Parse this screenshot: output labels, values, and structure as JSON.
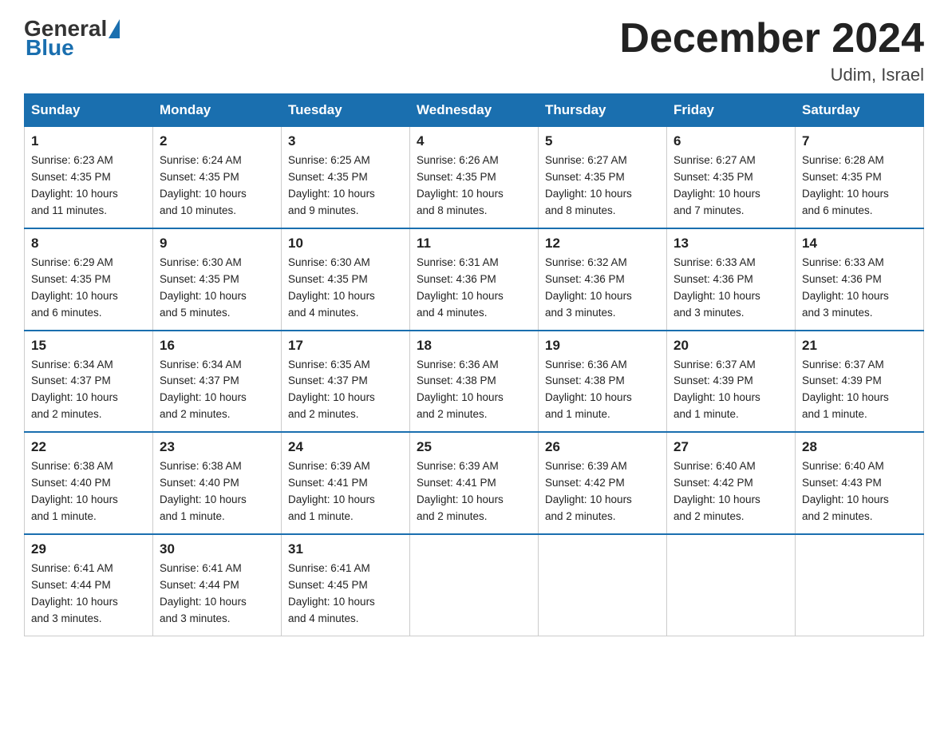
{
  "header": {
    "title": "December 2024",
    "location": "Udim, Israel",
    "logo_general": "General",
    "logo_blue": "Blue"
  },
  "weekdays": [
    "Sunday",
    "Monday",
    "Tuesday",
    "Wednesday",
    "Thursday",
    "Friday",
    "Saturday"
  ],
  "weeks": [
    [
      {
        "day": "1",
        "sunrise": "6:23 AM",
        "sunset": "4:35 PM",
        "daylight": "10 hours and 11 minutes."
      },
      {
        "day": "2",
        "sunrise": "6:24 AM",
        "sunset": "4:35 PM",
        "daylight": "10 hours and 10 minutes."
      },
      {
        "day": "3",
        "sunrise": "6:25 AM",
        "sunset": "4:35 PM",
        "daylight": "10 hours and 9 minutes."
      },
      {
        "day": "4",
        "sunrise": "6:26 AM",
        "sunset": "4:35 PM",
        "daylight": "10 hours and 8 minutes."
      },
      {
        "day": "5",
        "sunrise": "6:27 AM",
        "sunset": "4:35 PM",
        "daylight": "10 hours and 8 minutes."
      },
      {
        "day": "6",
        "sunrise": "6:27 AM",
        "sunset": "4:35 PM",
        "daylight": "10 hours and 7 minutes."
      },
      {
        "day": "7",
        "sunrise": "6:28 AM",
        "sunset": "4:35 PM",
        "daylight": "10 hours and 6 minutes."
      }
    ],
    [
      {
        "day": "8",
        "sunrise": "6:29 AM",
        "sunset": "4:35 PM",
        "daylight": "10 hours and 6 minutes."
      },
      {
        "day": "9",
        "sunrise": "6:30 AM",
        "sunset": "4:35 PM",
        "daylight": "10 hours and 5 minutes."
      },
      {
        "day": "10",
        "sunrise": "6:30 AM",
        "sunset": "4:35 PM",
        "daylight": "10 hours and 4 minutes."
      },
      {
        "day": "11",
        "sunrise": "6:31 AM",
        "sunset": "4:36 PM",
        "daylight": "10 hours and 4 minutes."
      },
      {
        "day": "12",
        "sunrise": "6:32 AM",
        "sunset": "4:36 PM",
        "daylight": "10 hours and 3 minutes."
      },
      {
        "day": "13",
        "sunrise": "6:33 AM",
        "sunset": "4:36 PM",
        "daylight": "10 hours and 3 minutes."
      },
      {
        "day": "14",
        "sunrise": "6:33 AM",
        "sunset": "4:36 PM",
        "daylight": "10 hours and 3 minutes."
      }
    ],
    [
      {
        "day": "15",
        "sunrise": "6:34 AM",
        "sunset": "4:37 PM",
        "daylight": "10 hours and 2 minutes."
      },
      {
        "day": "16",
        "sunrise": "6:34 AM",
        "sunset": "4:37 PM",
        "daylight": "10 hours and 2 minutes."
      },
      {
        "day": "17",
        "sunrise": "6:35 AM",
        "sunset": "4:37 PM",
        "daylight": "10 hours and 2 minutes."
      },
      {
        "day": "18",
        "sunrise": "6:36 AM",
        "sunset": "4:38 PM",
        "daylight": "10 hours and 2 minutes."
      },
      {
        "day": "19",
        "sunrise": "6:36 AM",
        "sunset": "4:38 PM",
        "daylight": "10 hours and 1 minute."
      },
      {
        "day": "20",
        "sunrise": "6:37 AM",
        "sunset": "4:39 PM",
        "daylight": "10 hours and 1 minute."
      },
      {
        "day": "21",
        "sunrise": "6:37 AM",
        "sunset": "4:39 PM",
        "daylight": "10 hours and 1 minute."
      }
    ],
    [
      {
        "day": "22",
        "sunrise": "6:38 AM",
        "sunset": "4:40 PM",
        "daylight": "10 hours and 1 minute."
      },
      {
        "day": "23",
        "sunrise": "6:38 AM",
        "sunset": "4:40 PM",
        "daylight": "10 hours and 1 minute."
      },
      {
        "day": "24",
        "sunrise": "6:39 AM",
        "sunset": "4:41 PM",
        "daylight": "10 hours and 1 minute."
      },
      {
        "day": "25",
        "sunrise": "6:39 AM",
        "sunset": "4:41 PM",
        "daylight": "10 hours and 2 minutes."
      },
      {
        "day": "26",
        "sunrise": "6:39 AM",
        "sunset": "4:42 PM",
        "daylight": "10 hours and 2 minutes."
      },
      {
        "day": "27",
        "sunrise": "6:40 AM",
        "sunset": "4:42 PM",
        "daylight": "10 hours and 2 minutes."
      },
      {
        "day": "28",
        "sunrise": "6:40 AM",
        "sunset": "4:43 PM",
        "daylight": "10 hours and 2 minutes."
      }
    ],
    [
      {
        "day": "29",
        "sunrise": "6:41 AM",
        "sunset": "4:44 PM",
        "daylight": "10 hours and 3 minutes."
      },
      {
        "day": "30",
        "sunrise": "6:41 AM",
        "sunset": "4:44 PM",
        "daylight": "10 hours and 3 minutes."
      },
      {
        "day": "31",
        "sunrise": "6:41 AM",
        "sunset": "4:45 PM",
        "daylight": "10 hours and 4 minutes."
      },
      null,
      null,
      null,
      null
    ]
  ],
  "labels": {
    "sunrise": "Sunrise:",
    "sunset": "Sunset:",
    "daylight": "Daylight:"
  }
}
